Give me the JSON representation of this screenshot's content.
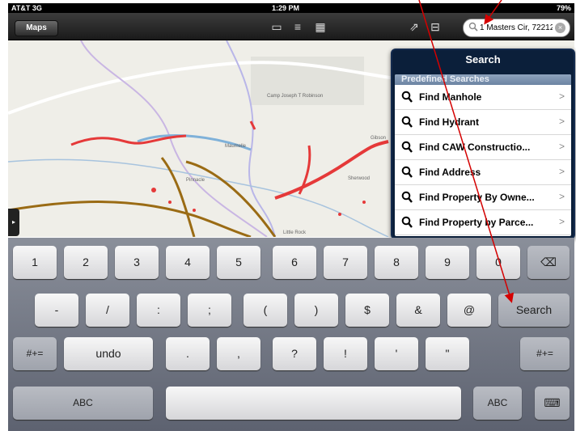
{
  "status_bar": {
    "carrier": "AT&T 3G",
    "time": "1:29 PM",
    "battery": "79%"
  },
  "toolbar": {
    "maps_label": "Maps",
    "search_value": "1 Masters Cir, 72212",
    "icons": [
      "layers-icon",
      "list-icon",
      "grid-icon",
      "share-icon",
      "bookmarks-icon"
    ]
  },
  "map": {
    "labels": [
      "Pinnacle",
      "Maumelle",
      "Camp Joseph T Robinson",
      "Sherwood",
      "Gibson",
      "Little Rock"
    ]
  },
  "popover": {
    "title": "Search",
    "section_header": "Predefined Searches",
    "items": [
      {
        "label": "Find Manhole"
      },
      {
        "label": "Find Hydrant"
      },
      {
        "label": "Find CAW Constructio..."
      },
      {
        "label": "Find Address"
      },
      {
        "label": "Find Property By Owne..."
      },
      {
        "label": "Find Property by Parce..."
      }
    ]
  },
  "keyboard": {
    "row1": [
      "1",
      "2",
      "3",
      "4",
      "5",
      "6",
      "7",
      "8",
      "9",
      "0"
    ],
    "row2": [
      "-",
      "/",
      ":",
      ";",
      "(",
      ")",
      "$",
      "&",
      "@"
    ],
    "search_label": "Search",
    "row3": [
      "#+=",
      "undo",
      ".",
      ",",
      "?",
      "!",
      "'",
      "\"",
      "#+="
    ],
    "row4": [
      "ABC",
      "ABC"
    ],
    "colors": {
      "accent_arrow": "#d40000",
      "popover_header": "#0b1f3a"
    }
  }
}
